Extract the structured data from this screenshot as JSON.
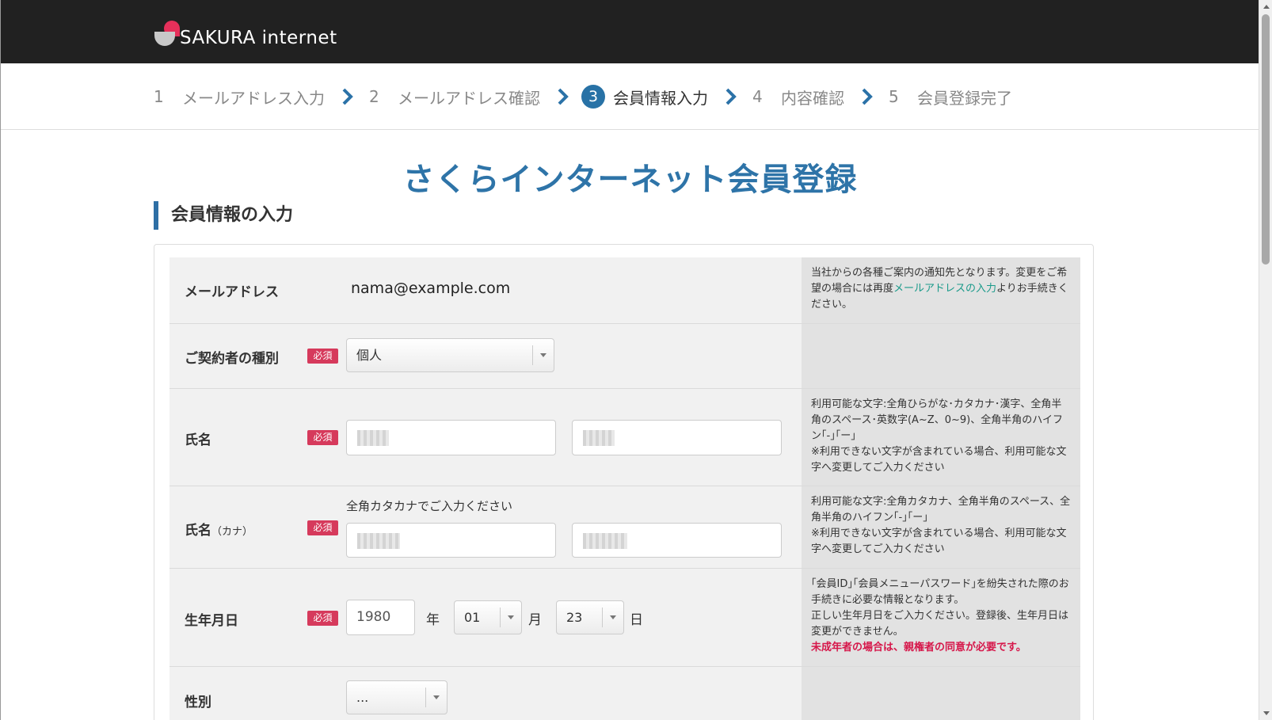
{
  "header": {
    "logo_text": "SAKURA internet"
  },
  "steps": [
    {
      "num": "1",
      "label": "メールアドレス入力",
      "active": false
    },
    {
      "num": "2",
      "label": "メールアドレス確認",
      "active": false
    },
    {
      "num": "3",
      "label": "会員情報入力",
      "active": true
    },
    {
      "num": "4",
      "label": "内容確認",
      "active": false
    },
    {
      "num": "5",
      "label": "会員登録完了",
      "active": false
    }
  ],
  "page_title": "さくらインターネット会員登録",
  "section_title": "会員情報の入力",
  "required_badge": "必須",
  "form": {
    "email": {
      "label": "メールアドレス",
      "value": "nama@example.com",
      "help_pre": "当社からの各種ご案内の通知先となります。変更をご希望の場合には再度",
      "help_link": "メールアドレスの入力",
      "help_post": "よりお手続きください。"
    },
    "contract_type": {
      "label": "ご契約者の種別",
      "selected": "個人"
    },
    "name": {
      "label": "氏名",
      "help": "利用可能な文字:全角ひらがな･カタカナ･漢字、全角半角のスペース･英数字(A~Z、0~9)、全角半角のハイフン｢-｣｢ー｣",
      "help2": "※利用できない文字が含まれている場合、利用可能な文字へ変更してご入力ください"
    },
    "name_kana": {
      "label": "氏名",
      "label_sub": "（カナ）",
      "note": "全角カタカナでご入力ください",
      "help": "利用可能な文字:全角カタカナ、全角半角のスペース、全角半角のハイフン｢-｣｢ー｣",
      "help2": "※利用できない文字が含まれている場合、利用可能な文字へ変更してご入力ください"
    },
    "birthdate": {
      "label": "生年月日",
      "year": "1980",
      "year_unit": "年",
      "month": "01",
      "month_unit": "月",
      "day": "23",
      "day_unit": "日",
      "help": "｢会員ID｣｢会員メニューパスワード｣を紛失された際のお手続きに必要な情報となります。",
      "help2": "正しい生年月日をご入力ください。登録後、生年月日は変更ができません。",
      "warn": "未成年者の場合は、親権者の同意が必要です。"
    },
    "gender": {
      "label": "性別",
      "selected": "..."
    }
  }
}
